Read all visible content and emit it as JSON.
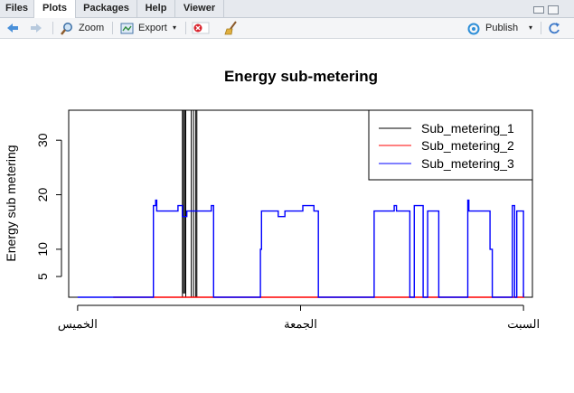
{
  "tabs": [
    {
      "label": "Files"
    },
    {
      "label": "Plots"
    },
    {
      "label": "Packages"
    },
    {
      "label": "Help"
    },
    {
      "label": "Viewer"
    }
  ],
  "toolbar": {
    "zoom_label": "Zoom",
    "export_label": "Export",
    "publish_label": "Publish",
    "icons": [
      "back-arrow-icon",
      "forward-arrow-icon",
      "zoom-icon",
      "export-icon",
      "remove-plot-icon",
      "broom-icon",
      "publish-icon"
    ]
  },
  "chart_data": {
    "type": "line",
    "title": "Energy sub-metering",
    "xlabel": "",
    "ylabel": "Energy sub metering",
    "x_tick_labels": [
      "الخميس",
      "الجمعة",
      "السبت"
    ],
    "y_ticks": [
      5,
      10,
      20,
      30
    ],
    "ylim": [
      1.2,
      35.5
    ],
    "xlim": [
      -0.04,
      2.04
    ],
    "legend_position": "top-right",
    "series": [
      {
        "name": "Sub_metering_1",
        "color": "#000000",
        "points": [
          [
            0.44,
            0
          ],
          [
            0.44,
            1
          ],
          [
            0.45,
            1
          ],
          [
            0.45,
            0
          ],
          [
            0.47,
            0
          ],
          [
            0.47,
            37
          ],
          [
            0.475,
            37
          ],
          [
            0.475,
            2
          ],
          [
            0.48,
            2
          ],
          [
            0.48,
            37
          ],
          [
            0.485,
            37
          ],
          [
            0.485,
            0
          ],
          [
            0.51,
            0
          ],
          [
            0.51,
            37
          ],
          [
            0.52,
            37
          ],
          [
            0.52,
            0
          ],
          [
            0.53,
            0
          ],
          [
            0.53,
            37
          ],
          [
            0.535,
            37
          ],
          [
            0.535,
            0
          ],
          [
            2.0,
            0
          ]
        ]
      },
      {
        "name": "Sub_metering_2",
        "color": "#ff0000",
        "points": [
          [
            0.16,
            0
          ],
          [
            0.16,
            1
          ],
          [
            0.165,
            1
          ],
          [
            0.165,
            0
          ],
          [
            0.275,
            0
          ],
          [
            0.275,
            1
          ],
          [
            0.28,
            1
          ],
          [
            0.28,
            0
          ],
          [
            0.38,
            0
          ],
          [
            0.38,
            1
          ],
          [
            0.385,
            1
          ],
          [
            0.385,
            0
          ],
          [
            0.55,
            0
          ],
          [
            0.55,
            1
          ],
          [
            0.555,
            1
          ],
          [
            0.555,
            0
          ],
          [
            0.65,
            0
          ],
          [
            0.65,
            1
          ],
          [
            0.655,
            1
          ],
          [
            0.655,
            0
          ],
          [
            0.75,
            0
          ],
          [
            0.75,
            1
          ],
          [
            0.755,
            1
          ],
          [
            0.755,
            0
          ],
          [
            0.85,
            0
          ],
          [
            0.85,
            1
          ],
          [
            0.855,
            1
          ],
          [
            0.855,
            0
          ],
          [
            0.95,
            0
          ],
          [
            0.95,
            1
          ],
          [
            0.955,
            1
          ],
          [
            0.955,
            0
          ],
          [
            1.06,
            0
          ],
          [
            1.06,
            1
          ],
          [
            1.065,
            1
          ],
          [
            1.065,
            0
          ],
          [
            1.16,
            0
          ],
          [
            1.16,
            1
          ],
          [
            1.165,
            1
          ],
          [
            1.165,
            0
          ],
          [
            1.26,
            0
          ],
          [
            1.26,
            1
          ],
          [
            1.265,
            1
          ],
          [
            1.265,
            0
          ],
          [
            1.36,
            0
          ],
          [
            1.36,
            1
          ],
          [
            1.365,
            1
          ],
          [
            1.365,
            0
          ],
          [
            1.46,
            0
          ],
          [
            1.46,
            1
          ],
          [
            1.465,
            1
          ],
          [
            1.465,
            0
          ],
          [
            1.57,
            0
          ],
          [
            1.57,
            1
          ],
          [
            1.575,
            1
          ],
          [
            1.575,
            0
          ],
          [
            1.67,
            0
          ],
          [
            1.67,
            1
          ],
          [
            1.675,
            1
          ],
          [
            1.675,
            0
          ],
          [
            1.77,
            0
          ],
          [
            1.77,
            1
          ],
          [
            1.775,
            1
          ],
          [
            1.775,
            0
          ],
          [
            1.87,
            0
          ],
          [
            1.87,
            1
          ],
          [
            1.875,
            1
          ],
          [
            1.875,
            0
          ],
          [
            2.0,
            0
          ],
          [
            2.0,
            2
          ]
        ]
      },
      {
        "name": "Sub_metering_3",
        "color": "#0000ff",
        "points": [
          [
            0.0,
            0
          ],
          [
            0.34,
            0
          ],
          [
            0.34,
            18
          ],
          [
            0.35,
            18
          ],
          [
            0.35,
            19
          ],
          [
            0.355,
            19
          ],
          [
            0.355,
            17
          ],
          [
            0.45,
            17
          ],
          [
            0.45,
            18
          ],
          [
            0.47,
            18
          ],
          [
            0.47,
            16
          ],
          [
            0.49,
            16
          ],
          [
            0.49,
            17
          ],
          [
            0.6,
            17
          ],
          [
            0.6,
            18
          ],
          [
            0.61,
            18
          ],
          [
            0.61,
            0
          ],
          [
            0.82,
            0
          ],
          [
            0.82,
            10
          ],
          [
            0.825,
            10
          ],
          [
            0.825,
            17
          ],
          [
            0.9,
            17
          ],
          [
            0.9,
            16
          ],
          [
            0.93,
            16
          ],
          [
            0.93,
            17
          ],
          [
            1.01,
            17
          ],
          [
            1.01,
            18
          ],
          [
            1.06,
            18
          ],
          [
            1.06,
            17
          ],
          [
            1.08,
            17
          ],
          [
            1.08,
            0
          ],
          [
            1.33,
            0
          ],
          [
            1.33,
            17
          ],
          [
            1.42,
            17
          ],
          [
            1.42,
            18
          ],
          [
            1.43,
            18
          ],
          [
            1.43,
            17
          ],
          [
            1.49,
            17
          ],
          [
            1.49,
            0
          ],
          [
            1.51,
            0
          ],
          [
            1.51,
            18
          ],
          [
            1.55,
            18
          ],
          [
            1.55,
            0
          ],
          [
            1.57,
            0
          ],
          [
            1.57,
            17
          ],
          [
            1.62,
            17
          ],
          [
            1.62,
            0
          ],
          [
            1.75,
            0
          ],
          [
            1.75,
            19
          ],
          [
            1.755,
            19
          ],
          [
            1.755,
            17
          ],
          [
            1.85,
            17
          ],
          [
            1.85,
            10
          ],
          [
            1.86,
            10
          ],
          [
            1.86,
            0
          ],
          [
            1.95,
            0
          ],
          [
            1.95,
            18
          ],
          [
            1.96,
            18
          ],
          [
            1.96,
            0
          ],
          [
            1.97,
            0
          ],
          [
            1.97,
            17
          ],
          [
            2.0,
            17
          ],
          [
            2.0,
            0
          ]
        ]
      }
    ]
  }
}
